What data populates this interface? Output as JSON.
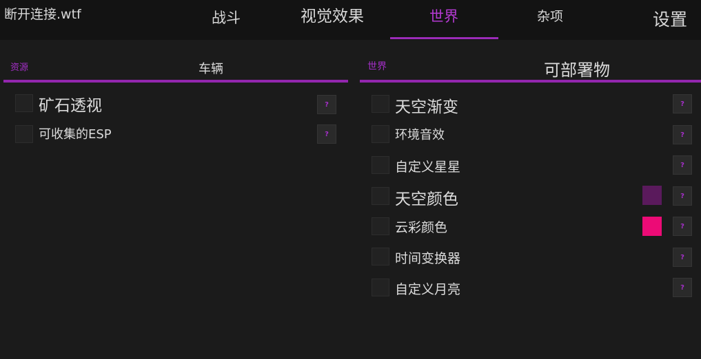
{
  "header": {
    "title": "断开连接.wtf",
    "tabs": [
      {
        "label": "战斗"
      },
      {
        "label": "视觉效果"
      },
      {
        "label": "世界"
      },
      {
        "label": "杂项"
      },
      {
        "label": "设置"
      }
    ],
    "active_tab": "世界",
    "accent_color": "#b53ad3"
  },
  "left_panel": {
    "section": "资源",
    "subtitle": "车辆",
    "items": [
      {
        "label": "矿石透视",
        "checked": false
      },
      {
        "label": "可收集的ESP",
        "checked": false
      }
    ]
  },
  "right_panel": {
    "section": "世界",
    "subtitle": "可部署物",
    "items": [
      {
        "label": "天空渐变",
        "checked": false
      },
      {
        "label": "环境音效",
        "checked": false
      },
      {
        "label": "自定义星星",
        "checked": false
      },
      {
        "label": "天空颜色",
        "checked": false,
        "color": "#5a1a5c"
      },
      {
        "label": "云彩颜色",
        "checked": false,
        "color": "#ec0b76"
      },
      {
        "label": "时间变换器",
        "checked": false
      },
      {
        "label": "自定义月亮",
        "checked": false
      }
    ]
  },
  "help_glyph": "?"
}
